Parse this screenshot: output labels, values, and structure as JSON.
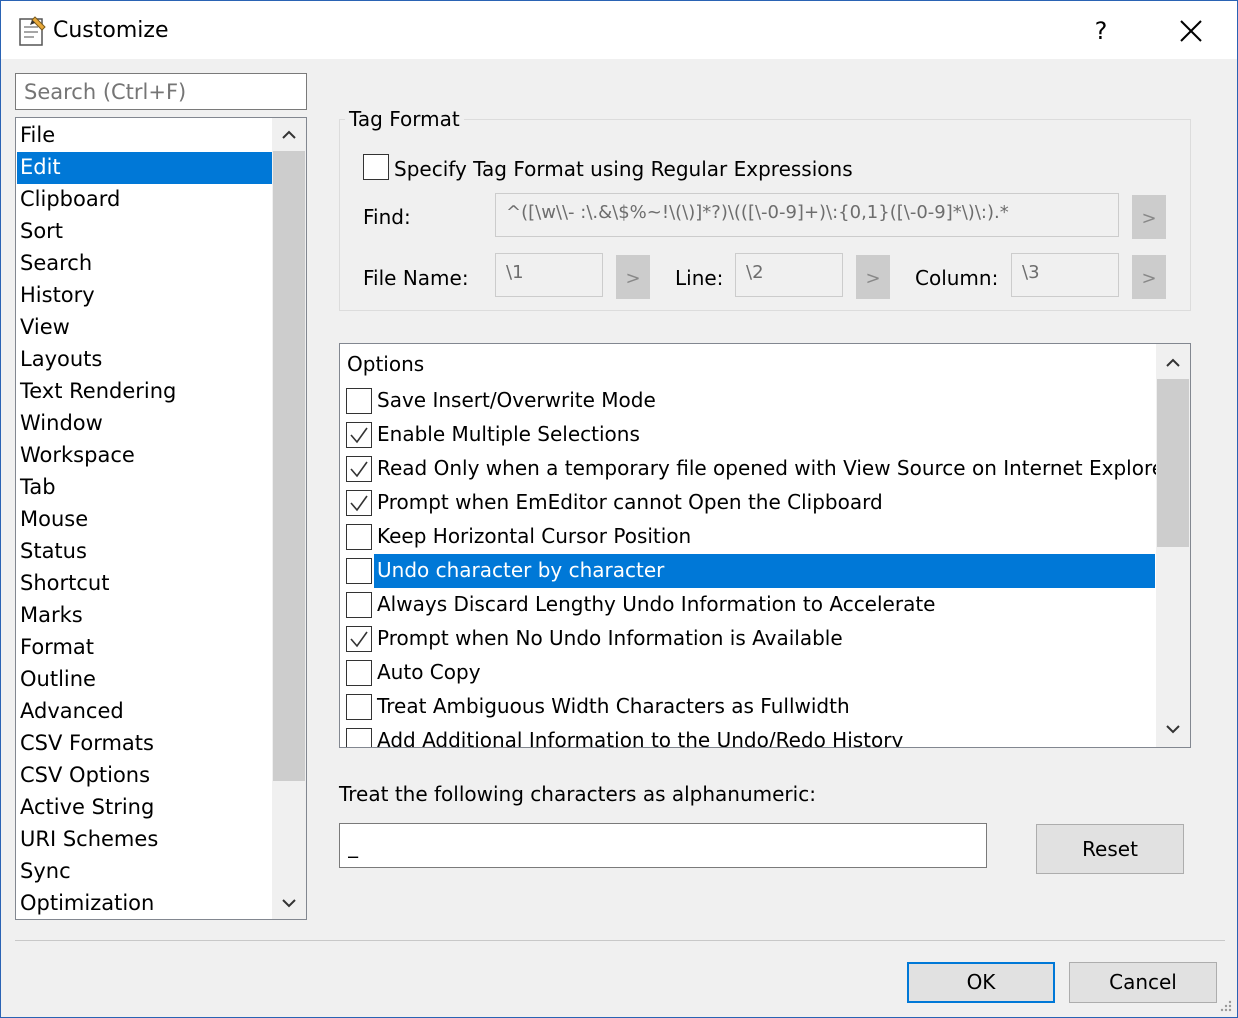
{
  "window": {
    "title": "Customize",
    "help_label": "?"
  },
  "sidebar": {
    "search_placeholder": "Search (Ctrl+F)",
    "selected": "Edit",
    "items": [
      "File",
      "Edit",
      "Clipboard",
      "Sort",
      "Search",
      "History",
      "View",
      "Layouts",
      "Text Rendering",
      "Window",
      "Workspace",
      "Tab",
      "Mouse",
      "Status",
      "Shortcut",
      "Marks",
      "Format",
      "Outline",
      "Advanced",
      "CSV Formats",
      "CSV Options",
      "Active String",
      "URI Schemes",
      "Sync",
      "Optimization"
    ]
  },
  "tag_format": {
    "group_label": "Tag Format",
    "regex_checkbox_label": "Specify Tag Format using Regular Expressions",
    "regex_checked": false,
    "find_label": "Find:",
    "find_value": "^([\\w\\\\- :\\.&\\$%~!\\(\\)]*?)\\(([\\-0-9]+)\\:{0,1}([\\-0-9]*\\)\\:).*",
    "file_name_label": "File Name:",
    "file_name_value": "\\1",
    "line_label": "Line:",
    "line_value": "\\2",
    "column_label": "Column:",
    "column_value": "\\3",
    "arrow_label": ">"
  },
  "options": {
    "header": "Options",
    "items": [
      {
        "label": "Save Insert/Overwrite Mode",
        "checked": false,
        "selected": false
      },
      {
        "label": "Enable Multiple Selections",
        "checked": true,
        "selected": false
      },
      {
        "label": "Read Only when a temporary file opened with View Source on Internet Explorer",
        "checked": true,
        "selected": false
      },
      {
        "label": "Prompt when EmEditor cannot Open the Clipboard",
        "checked": true,
        "selected": false
      },
      {
        "label": "Keep Horizontal Cursor Position",
        "checked": false,
        "selected": false
      },
      {
        "label": "Undo character by character",
        "checked": false,
        "selected": true
      },
      {
        "label": "Always Discard Lengthy Undo Information to Accelerate",
        "checked": false,
        "selected": false
      },
      {
        "label": "Prompt when No Undo Information is Available",
        "checked": true,
        "selected": false
      },
      {
        "label": "Auto Copy",
        "checked": false,
        "selected": false
      },
      {
        "label": "Treat Ambiguous Width Characters as Fullwidth",
        "checked": false,
        "selected": false
      },
      {
        "label": "Add Additional Information to the Undo/Redo History",
        "checked": false,
        "selected": false
      }
    ]
  },
  "alphanumeric": {
    "label": "Treat the following characters as alphanumeric:",
    "value": "_",
    "reset_label": "Reset"
  },
  "footer": {
    "ok_label": "OK",
    "cancel_label": "Cancel"
  },
  "colors": {
    "accent": "#0078d7",
    "window_bg": "#f0f0f0"
  }
}
